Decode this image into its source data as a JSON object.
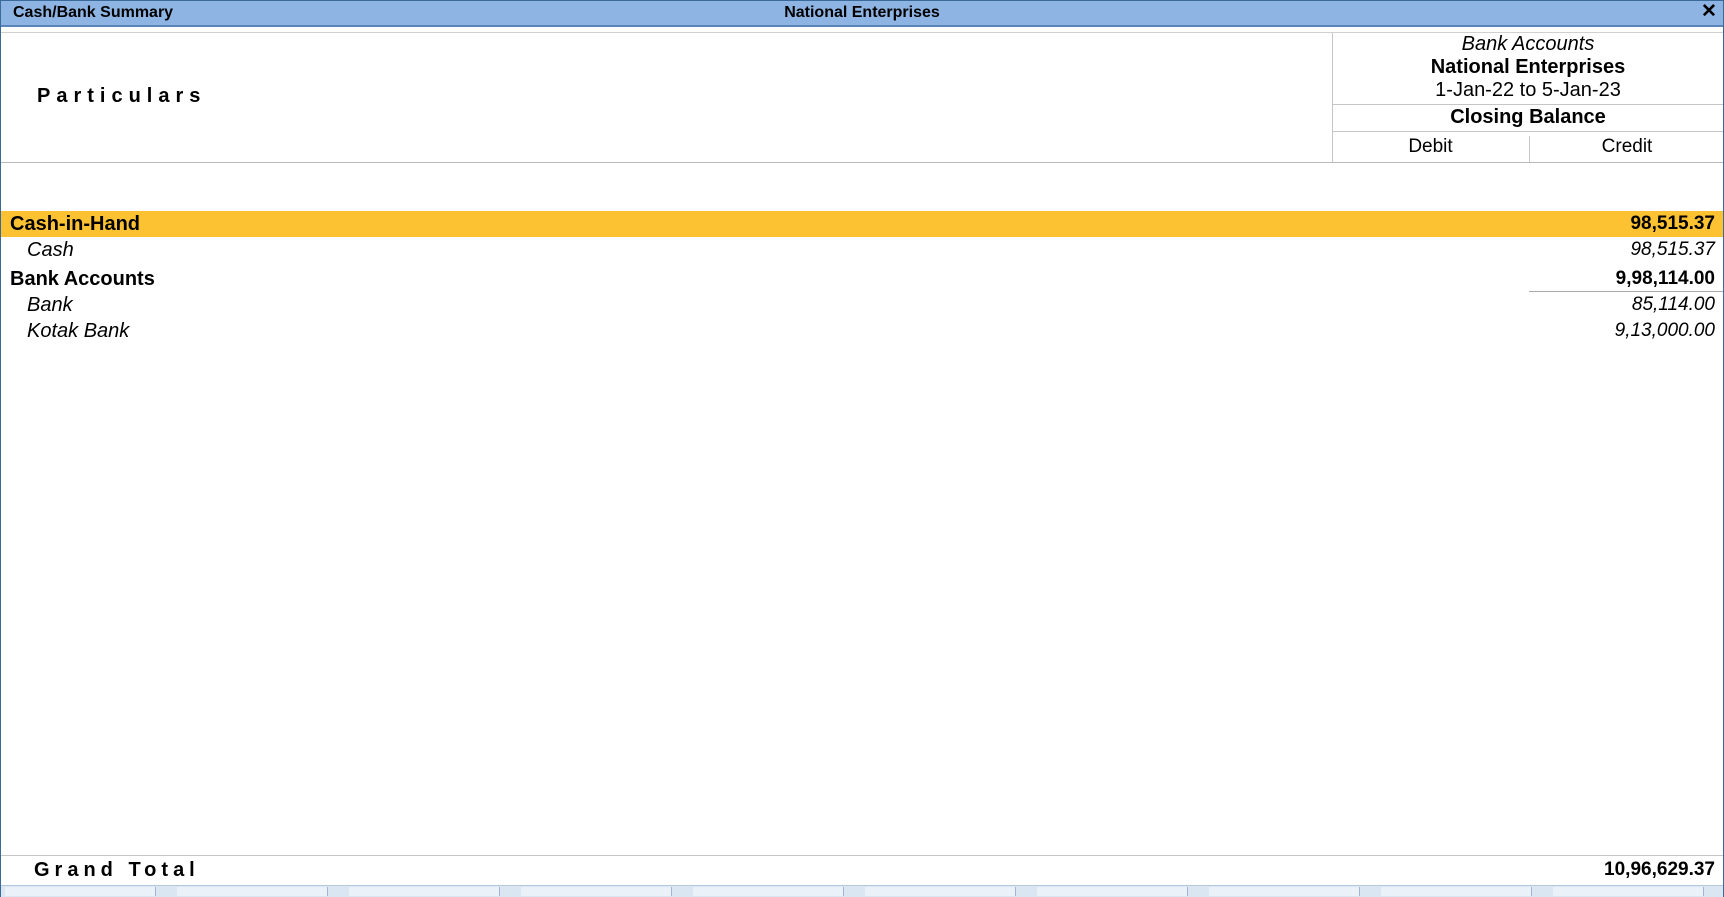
{
  "titlebar": {
    "title": "Cash/Bank Summary",
    "company": "National Enterprises",
    "close_icon": "close-icon"
  },
  "header": {
    "particulars": "Particulars",
    "report_name": "Bank Accounts",
    "company": "National Enterprises",
    "period": "1-Jan-22 to 5-Jan-23",
    "closing_balance": "Closing Balance",
    "debit": "Debit",
    "credit": "Credit"
  },
  "rows": [
    {
      "name": "Cash-in-Hand",
      "amount": "98,515.37",
      "type": "group",
      "highlighted": true
    },
    {
      "name": "Cash",
      "amount": "98,515.37",
      "type": "ledger"
    },
    {
      "name": "Bank Accounts",
      "amount": "9,98,114.00",
      "type": "group"
    },
    {
      "name": "Bank",
      "amount": "85,114.00",
      "type": "ledger"
    },
    {
      "name": "Kotak Bank",
      "amount": "9,13,000.00",
      "type": "ledger"
    }
  ],
  "footer": {
    "grand_total_label": "Grand Total",
    "grand_total_amount": "10,96,629.37"
  },
  "colors": {
    "titlebar": "#8db4e2",
    "highlight": "#fdc231"
  }
}
